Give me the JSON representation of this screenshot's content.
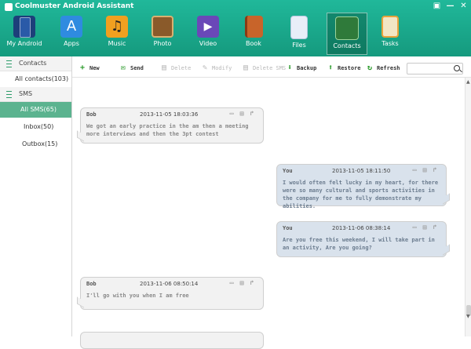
{
  "app": {
    "title": "Coolmuster Android Assistant",
    "window_buttons": [
      "▣",
      "—",
      "✕"
    ]
  },
  "nav": [
    {
      "label": "My Android",
      "icon": "phone-icon",
      "color": "#2a5aa8"
    },
    {
      "label": "Apps",
      "icon": "appstore-icon",
      "color": "#2f8be0"
    },
    {
      "label": "Music",
      "icon": "music-icon",
      "color": "#f0a020"
    },
    {
      "label": "Photo",
      "icon": "photo-icon",
      "color": "#8a5a2a"
    },
    {
      "label": "Video",
      "icon": "video-icon",
      "color": "#6a48b8"
    },
    {
      "label": "Book",
      "icon": "book-icon",
      "color": "#c8642a"
    },
    {
      "label": "Files",
      "icon": "files-icon",
      "color": "#e8eef8"
    },
    {
      "label": "Contacts",
      "icon": "contacts-icon",
      "color": "#2f7a3a",
      "active": true
    },
    {
      "label": "Tasks",
      "icon": "tasks-icon",
      "color": "#e8a23a"
    }
  ],
  "sidebar": {
    "contacts_header": "Contacts",
    "all_contacts": "All contacts(103)",
    "sms_header": "SMS",
    "all_sms": "All SMS(65)",
    "inbox": "Inbox(50)",
    "outbox": "Outbox(15)"
  },
  "toolbar": {
    "new": "New",
    "send": "Send",
    "delete": "Delete",
    "modify": "Modify",
    "delete_sms": "Delete SMS",
    "backup": "Backup",
    "restore": "Restore",
    "refresh": "Refresh",
    "search_placeholder": ""
  },
  "messages": [
    {
      "sender": "Bob",
      "time": "2013-11-05 18:03:36",
      "text": "We got an early practice in the am then a meeting more interviews and then the 3pt contest",
      "dir": "in"
    },
    {
      "sender": "You",
      "time": "2013-11-05 18:11:50",
      "text": "I would often felt lucky in my heart, for there were so many cultural and sports activities in the company for me to fully demonstrate my abilities.",
      "dir": "out"
    },
    {
      "sender": "You",
      "time": "2013-11-06 08:38:14",
      "text": "Are you free this weekend, I will  take part in an activity, Are you going?",
      "dir": "out"
    },
    {
      "sender": "Bob",
      "time": "2013-11-06 08:50:14",
      "text": "I'll go with you when I am free",
      "dir": "in"
    }
  ],
  "colors": {
    "header": "#18a98a",
    "sidebar_active": "#5bb38f",
    "bubble_in": "#f2f2f2",
    "bubble_out": "#d9e2ec"
  }
}
